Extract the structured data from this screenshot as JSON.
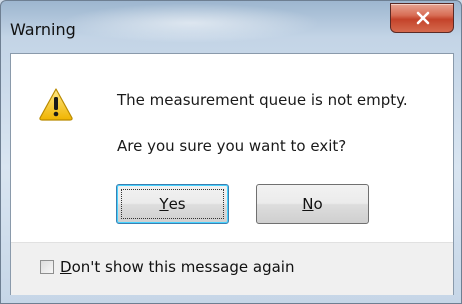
{
  "window": {
    "title": "Warning",
    "close_label": "x"
  },
  "dialog": {
    "icon": "warning-triangle-icon",
    "message_line1": "The measurement queue is not empty.",
    "message_line2": "Are you sure you want to exit?",
    "yes_mnemonic": "Y",
    "yes_rest": "es",
    "no_mnemonic": "N",
    "no_rest": "o",
    "checkbox_mnemonic": "D",
    "checkbox_rest": "on't show this message again",
    "checkbox_checked": false
  },
  "colors": {
    "close_button": "#c4432a",
    "warning_yellow": "#f5c518",
    "focus_border": "#3c7fb1"
  }
}
